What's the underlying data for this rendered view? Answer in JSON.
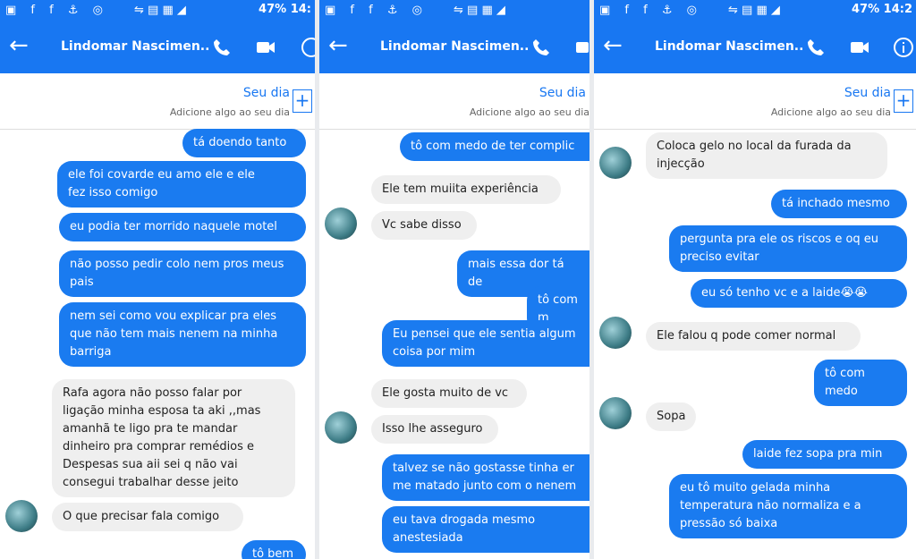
{
  "status": {
    "left_icons": "▣ f f ⚓ ◎",
    "mid": "⇋  ▤ ▦ ◢",
    "battery": "47%",
    "time_1": "14:",
    "time_3": "14:2"
  },
  "header": {
    "back": "←",
    "name_1": "Lindomar Nascimen..",
    "name_2": "Lindomar Nascimen..",
    "name_3": "Lindomar Nascimen.."
  },
  "story": {
    "title": "Seu dia",
    "subtitle": "Adicione algo ao seu dia",
    "plus": "+"
  },
  "panel1": [
    "tá doendo tanto",
    "ele foi covarde eu amo ele e ele\nfez isso comigo",
    "eu podia ter morrido naquele motel",
    "não posso pedir colo nem pros meus\npais",
    "nem sei como vou explicar pra eles\nque não tem  mais nenem na minha\nbarriga",
    "Rafa agora não posso falar por\nligação minha esposa ta aki ,,mas\namanhã te ligo pra te mandar\ndinheiro pra comprar remédios e\nDespesas sua aii sei q não vai\nconsegui trabalhar desse jeito",
    "O que precisar fala comigo",
    "tô bem"
  ],
  "panel2": [
    "tô com medo de ter complic",
    "Ele tem muiita experiência",
    "Vc sabe disso",
    "mais essa dor tá de",
    "tô com m",
    "Eu pensei que ele sentia algum\ncoisa por mim",
    "Ele gosta muito de vc",
    "Isso lhe asseguro",
    "talvez se não gostasse tinha er\nme matado junto com o nenem",
    "eu tava drogada mesmo\nanestesiada"
  ],
  "panel3": [
    "Coloca gelo no local da furada da\ninjecção",
    "tá inchado mesmo",
    "pergunta pra ele os riscos e oq eu\npreciso evitar",
    "eu só tenho vc e a laide😭😭",
    "Ele falou q pode comer normal",
    "tô com medo",
    "Sopa",
    "laide fez sopa pra min",
    "eu tô muito gelada minha\ntemperatura não normaliza e a\npressão só baixa"
  ]
}
